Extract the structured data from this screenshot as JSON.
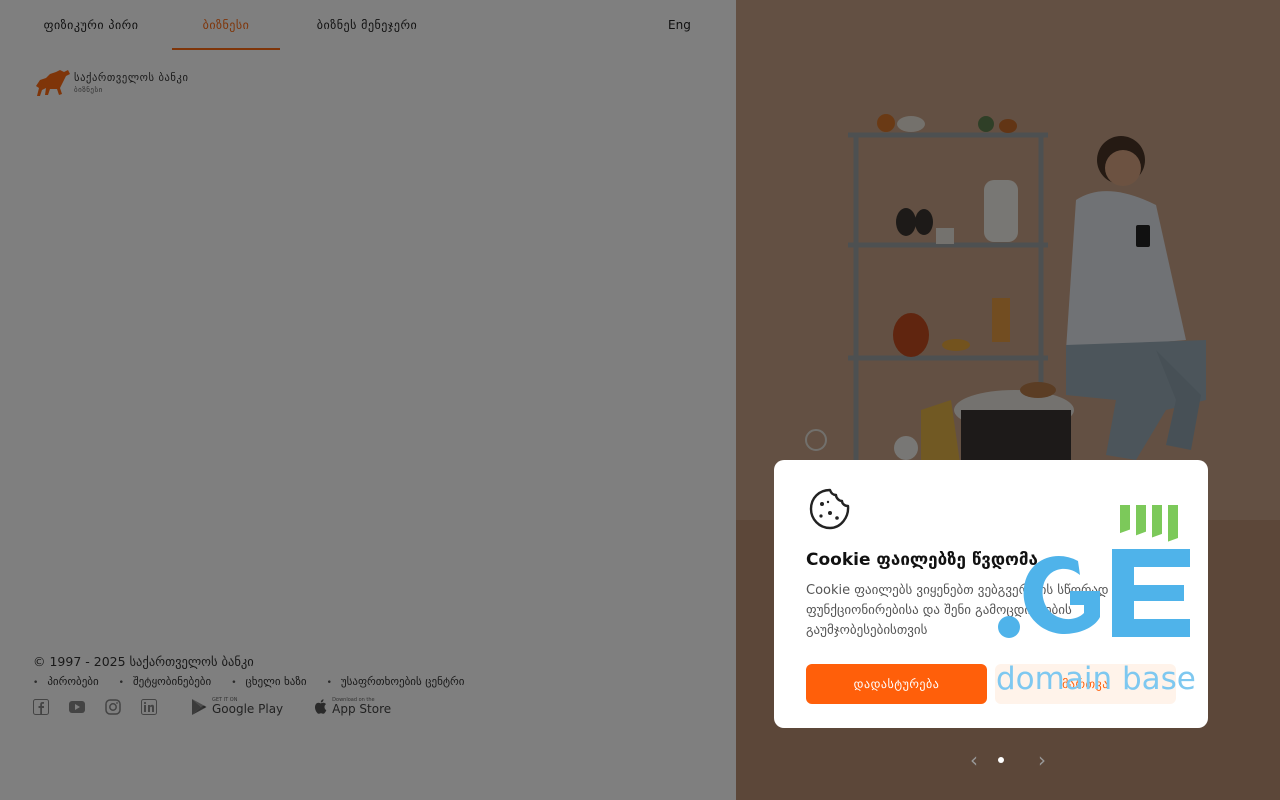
{
  "nav": {
    "tabs": [
      {
        "label": "ფიზიკური პირი"
      },
      {
        "label": "ბიზნესი"
      },
      {
        "label": "ბიზნეს მენეჯერი"
      }
    ],
    "lang": "Eng"
  },
  "logo": {
    "name": "საქართველოს ბანკი",
    "sub": "ბიზნესი"
  },
  "footer": {
    "copyright": "© 1997 - 2025 საქართველოს ბანკი",
    "links": [
      "პირობები",
      "შეტყობინებები",
      "ცხელი ხაზი",
      "უსაფრთხოების ცენტრი"
    ],
    "social_icons": [
      "facebook-icon",
      "youtube-icon",
      "instagram-icon",
      "linkedin-icon"
    ],
    "stores": [
      {
        "small": "GET IT ON",
        "name": "Google Play"
      },
      {
        "small": "Download on the",
        "name": "App Store"
      }
    ]
  },
  "cookie": {
    "title": "Cookie ფაილებზე წვდომა",
    "body": "Cookie ფაილებს ვიყენებთ ვებგვერდის სწორად ფუნქციონირებისა და შენი გამოცდილების გაუმჯობესებისთვის",
    "accept": "დადასტურება",
    "manage": "მართვა"
  },
  "watermark": {
    "text": "domain base",
    "mark": ".GE"
  },
  "colors": {
    "accent": "#ff5f0a",
    "watermark_blue": "#4fb3ea",
    "watermark_green": "#7cc95a"
  }
}
